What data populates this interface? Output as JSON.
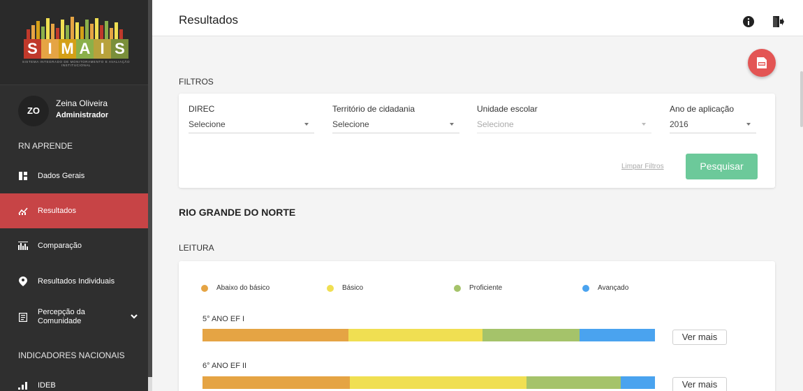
{
  "app": {
    "logo_letters": [
      "S",
      "I",
      "M",
      "A",
      "I",
      "S"
    ],
    "logo_subtitle": "SISTEMA INTEGRADO DE MONITORAMENTO E AVALIAÇÃO INSTITUCIONAL"
  },
  "user": {
    "initials": "ZO",
    "name": "Zeina Oliveira",
    "role": "Administrador"
  },
  "sidebar": {
    "section_1": "RN APRENDE",
    "items": [
      {
        "label": "Dados Gerais",
        "icon": "dashboard-icon"
      },
      {
        "label": "Resultados",
        "icon": "chart-line-icon",
        "active": true
      },
      {
        "label": "Comparação",
        "icon": "bar-compare-icon"
      },
      {
        "label": "Resultados Individuais",
        "icon": "person-pin-icon"
      },
      {
        "label": "Percepção da Comunidade",
        "label_line1": "Percepção da",
        "label_line2": "Comunidade",
        "icon": "survey-icon"
      }
    ],
    "section_2": "INDICADORES NACIONAIS",
    "items_2": [
      {
        "label": "IDEB",
        "icon": "signal-bars-icon"
      }
    ]
  },
  "header": {
    "title": "Resultados"
  },
  "filters": {
    "heading": "FILTROS",
    "direc": {
      "label": "DIREC",
      "value": "Selecione"
    },
    "territorio": {
      "label": "Território de cidadania",
      "value": "Selecione"
    },
    "unidade": {
      "label": "Unidade escolar",
      "value": "Selecione"
    },
    "ano": {
      "label": "Ano de aplicação",
      "value": "2016"
    },
    "clear_label": "Limpar Filtros",
    "search_label": "Pesquisar"
  },
  "region": "RIO GRANDE DO NORTE",
  "subject": "LEITURA",
  "legend": [
    {
      "label": "Abaixo do básico",
      "color": "#e5a444"
    },
    {
      "label": "Básico",
      "color": "#f0df52"
    },
    {
      "label": "Proficiente",
      "color": "#a5c36a"
    },
    {
      "label": "Avançado",
      "color": "#4aa3ef"
    }
  ],
  "results": [
    {
      "label": "5° ANO EF I",
      "fractions": [
        0.322,
        0.296,
        0.215,
        0.167
      ],
      "more_label": "Ver mais"
    },
    {
      "label": "6° ANO EF II",
      "fractions": [
        0.326,
        0.391,
        0.208,
        0.075
      ],
      "more_label": "Ver mais"
    }
  ]
}
